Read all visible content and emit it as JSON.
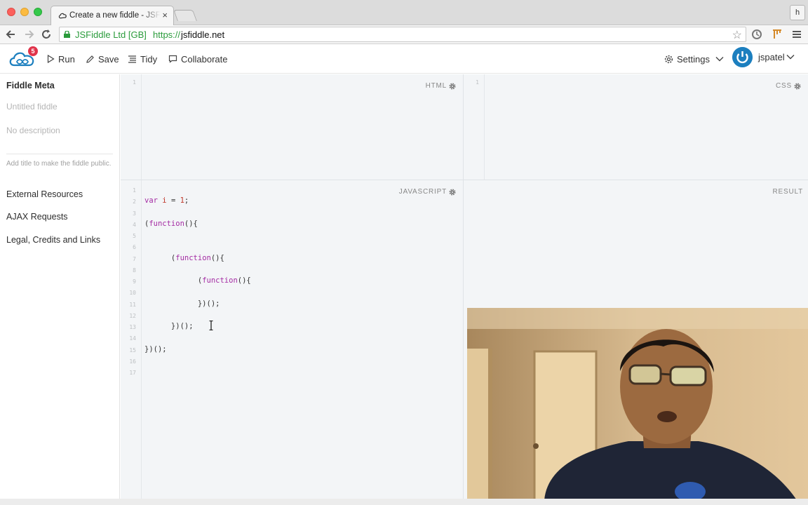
{
  "browser": {
    "tab_title": "Create a new fiddle - JSFiddle",
    "tab_close": "×",
    "ev_label": "JSFiddle Ltd [GB]",
    "url_scheme": "https://",
    "url_host": "jsfiddle.net",
    "profile_initial": "h"
  },
  "header": {
    "notification_count": "5",
    "run_label": "Run",
    "save_label": "Save",
    "tidy_label": "Tidy",
    "collaborate_label": "Collaborate",
    "settings_label": "Settings",
    "username": "jspatel"
  },
  "sidebar": {
    "title": "Fiddle Meta",
    "title_placeholder": "Untitled fiddle",
    "description_placeholder": "No description",
    "hint": "Add title to make the fiddle public.",
    "links": [
      "External Resources",
      "AJAX Requests",
      "Legal, Credits and Links"
    ]
  },
  "panels": {
    "html_label": "HTML",
    "css_label": "CSS",
    "js_label": "JAVASCRIPT",
    "result_label": "RESULT",
    "html_line": "1",
    "css_line": "1"
  },
  "javascript_code": [
    "",
    "var i = 1;",
    "",
    "(function(){",
    "",
    "",
    "      (function(){",
    "",
    "            (function(){",
    "",
    "            })();",
    "",
    "      })();",
    "",
    "})();",
    "",
    ""
  ],
  "colors": {
    "accent": "#1c7fbf",
    "badge": "#e0344b",
    "keyword": "#a42ba3",
    "number": "#c0392b",
    "secure_green": "#2a9b3b"
  }
}
